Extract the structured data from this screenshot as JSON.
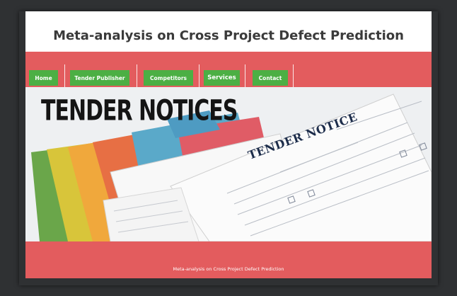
{
  "site": {
    "title": "Meta-analysis on Cross Project Defect Prediction"
  },
  "nav": {
    "items": [
      {
        "label": "Home"
      },
      {
        "label": "Tender Publisher"
      },
      {
        "label": "Competitors"
      },
      {
        "label": "Services"
      },
      {
        "label": "Contact"
      }
    ]
  },
  "hero": {
    "heading": "TENDER NOTICES",
    "document_title": "TENDER NOTICE"
  },
  "footer": {
    "text": "Meta-analysis on Cross Project Defect Prediction"
  },
  "colors": {
    "nav_background": "#e35c5e",
    "button_green": "#4caf44",
    "page_background": "#2f3133"
  }
}
